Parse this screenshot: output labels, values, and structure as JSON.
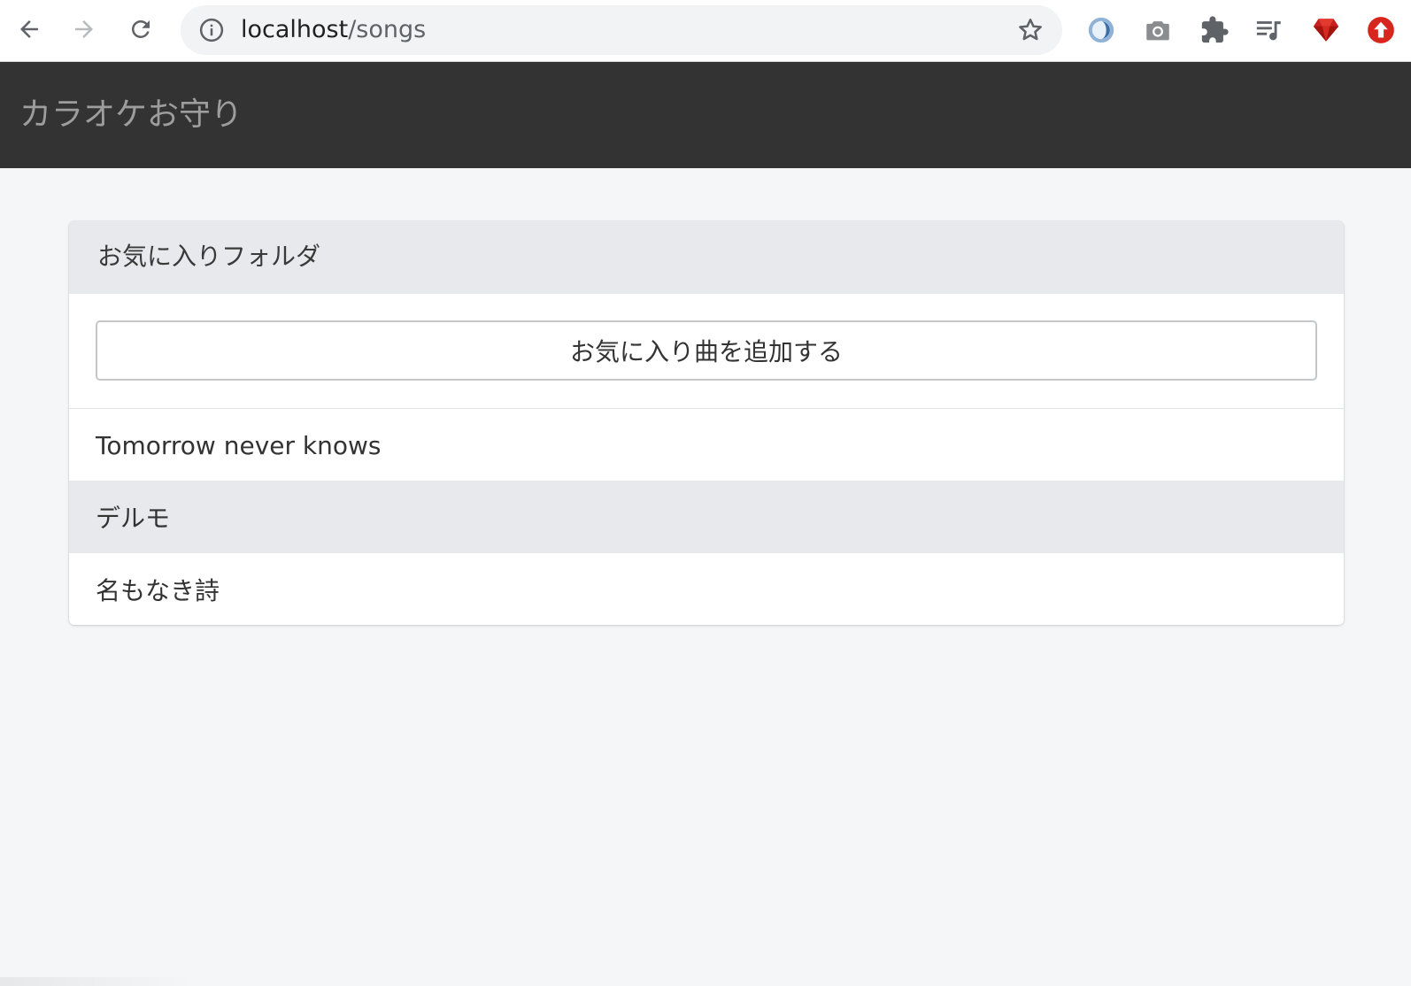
{
  "browser": {
    "url_host": "localhost",
    "url_path": "/songs",
    "icons": {
      "back": "back-arrow-icon",
      "forward": "forward-arrow-icon",
      "reload": "reload-icon",
      "info": "info-icon",
      "bookmark": "star-icon",
      "extensions": [
        "blue-circle-extension-icon",
        "camera-icon",
        "puzzle-icon",
        "playlist-icon",
        "ruby-icon",
        "red-upload-icon"
      ]
    },
    "forward_disabled": true
  },
  "header": {
    "app_title": "カラオケお守り",
    "background_color": "#333333",
    "title_color": "#9d9d9d"
  },
  "card": {
    "title": "お気に入りフォルダ",
    "add_button_label": "お気に入り曲を追加する",
    "songs": [
      {
        "title": "Tomorrow never knows",
        "active": false
      },
      {
        "title": "デルモ",
        "active": true
      },
      {
        "title": "名もなき詩",
        "active": false
      }
    ]
  }
}
